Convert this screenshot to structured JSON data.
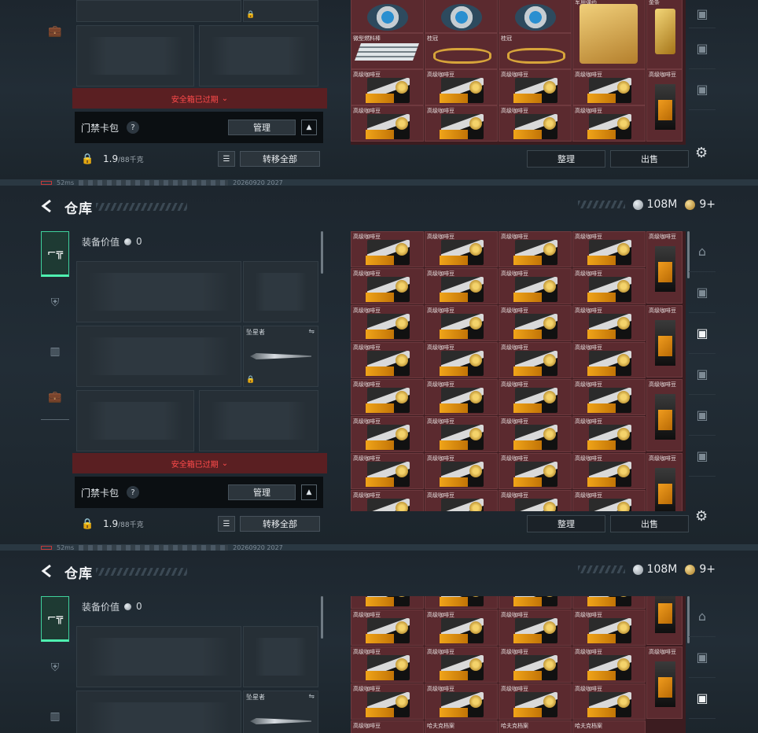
{
  "header": {
    "title": "仓库",
    "silver_value": "108M",
    "gold_value": "9+"
  },
  "status_strip": {
    "ping": "52ms",
    "id": "20260920 2027"
  },
  "equipment": {
    "value_label": "装备价值",
    "value": "0",
    "melee_name": "坠星者"
  },
  "safe_box_expired": "安全箱已过期",
  "card_pack": {
    "label": "门禁卡包",
    "help": "?",
    "manage": "管理"
  },
  "weight": {
    "current": "1.9",
    "max": "/88千克",
    "transfer_all": "转移全部"
  },
  "stash": {
    "sort": "整理",
    "sell": "出售",
    "items_top": [
      {
        "name": "微型燃料棒"
      },
      {
        "name": "桂冠"
      },
      {
        "name": "桂冠"
      },
      {
        "name": "军用弹药"
      },
      {
        "name": "金条"
      }
    ],
    "coffee_name": "高级咖啡豆",
    "bottom_labels": [
      "高级咖啡豆",
      "哈夫克档案",
      "哈夫克档案",
      "哈夫克档案"
    ]
  }
}
